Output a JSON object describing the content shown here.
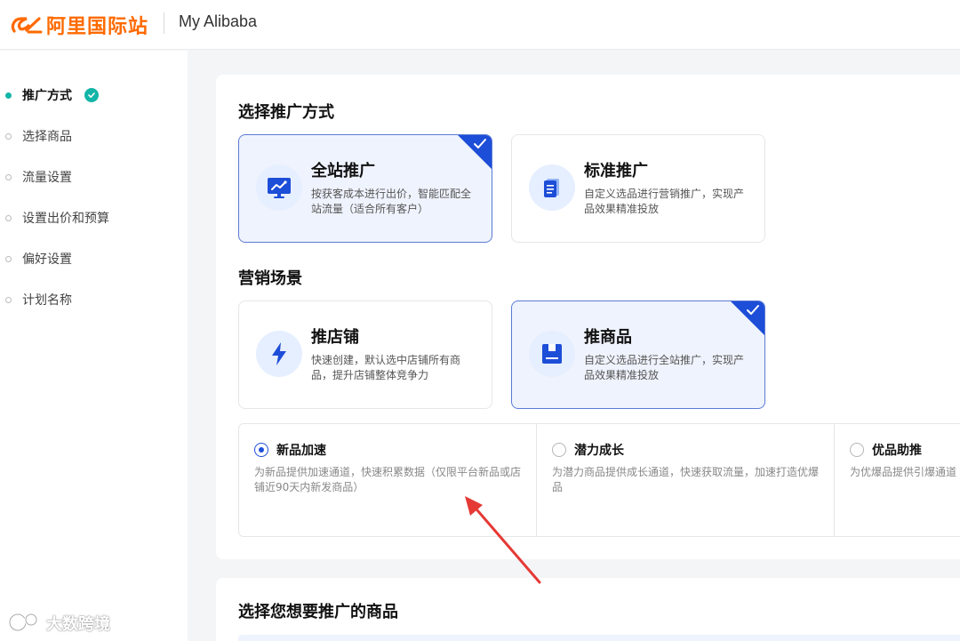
{
  "header": {
    "logo_text": "阿里国际站",
    "title": "My Alibaba",
    "brand_color": "#ff6a00"
  },
  "sidebar": {
    "steps": [
      {
        "label": "推广方式",
        "active": true,
        "completed": true
      },
      {
        "label": "选择商品"
      },
      {
        "label": "流量设置"
      },
      {
        "label": "设置出价和预算"
      },
      {
        "label": "偏好设置"
      },
      {
        "label": "计划名称"
      }
    ]
  },
  "promotion_method": {
    "title": "选择推广方式",
    "cards": [
      {
        "title": "全站推广",
        "desc": "按获客成本进行出价，智能匹配全站流量（适合所有客户）",
        "selected": true,
        "icon": "monitor-chart-icon"
      },
      {
        "title": "标准推广",
        "desc": "自定义选品进行营销推广，实现产品效果精准投放",
        "selected": false,
        "icon": "document-icon"
      }
    ]
  },
  "marketing_scene": {
    "title": "营销场景",
    "cards": [
      {
        "title": "推店铺",
        "desc": "快速创建，默认选中店铺所有商品，提升店铺整体竞争力",
        "selected": false,
        "icon": "lightning-icon"
      },
      {
        "title": "推商品",
        "desc": "自定义选品进行全站推广，实现产品效果精准投放",
        "selected": true,
        "icon": "product-box-icon"
      }
    ]
  },
  "options": [
    {
      "title": "新品加速",
      "desc": "为新品提供加速通道，快速积累数据（仅限平台新品或店铺近90天内新发商品）",
      "checked": true
    },
    {
      "title": "潜力成长",
      "desc": "为潜力商品提供成长通道，快速获取流量，加速打造优爆品",
      "checked": false
    },
    {
      "title": "优品助推",
      "desc": "为优爆品提供引爆通道",
      "checked": false
    }
  ],
  "product_section": {
    "title": "选择您想要推广的商品"
  },
  "watermark": {
    "text": "大数跨境"
  },
  "colors": {
    "accent": "#1d4ed8",
    "step_active": "#13b5a7",
    "annotation_arrow": "#e53935"
  }
}
